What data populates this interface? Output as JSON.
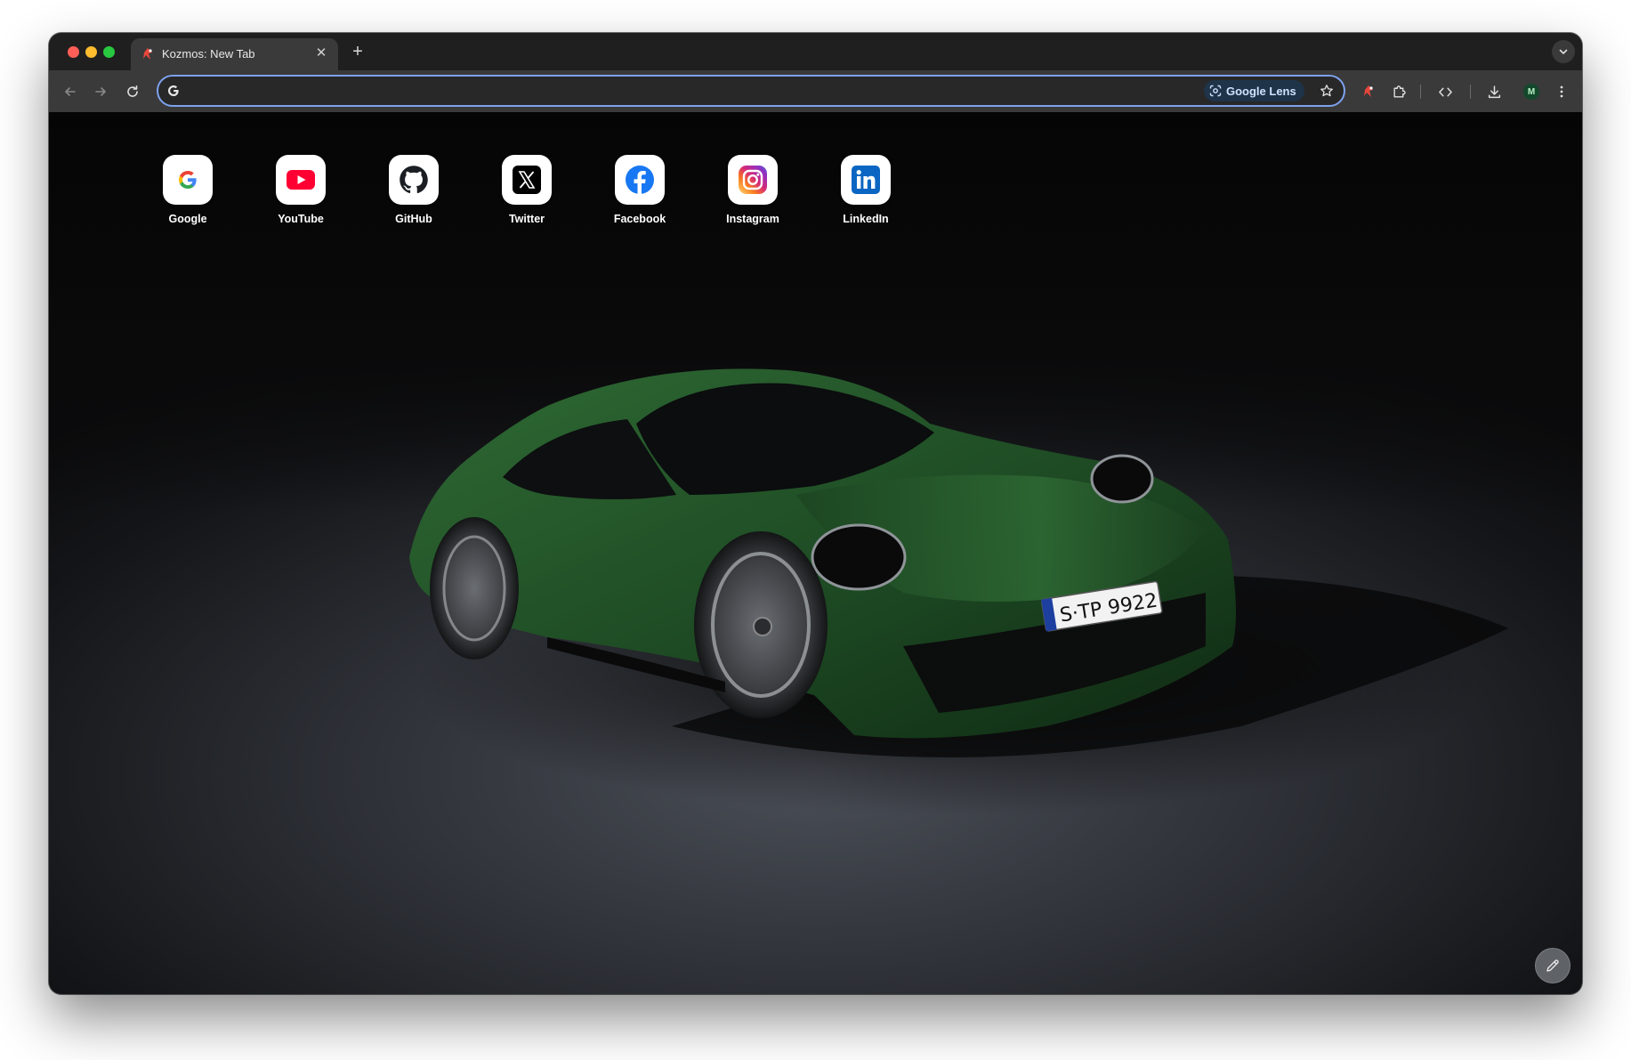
{
  "window": {
    "traffic_lights": [
      "close",
      "minimize",
      "zoom"
    ],
    "tab": {
      "title": "Kozmos: New Tab",
      "close_glyph": "✕",
      "favicon": "kozmos-icon"
    },
    "new_tab_glyph": "+"
  },
  "toolbar": {
    "omnibox": {
      "value": "",
      "engine_icon": "google-g-icon",
      "lens_label": "Google Lens"
    },
    "avatar_letter": "M"
  },
  "shortcuts": [
    {
      "label": "Google",
      "icon": "google-icon"
    },
    {
      "label": "YouTube",
      "icon": "youtube-icon"
    },
    {
      "label": "GitHub",
      "icon": "github-icon"
    },
    {
      "label": "Twitter",
      "icon": "x-twitter-icon"
    },
    {
      "label": "Facebook",
      "icon": "facebook-icon"
    },
    {
      "label": "Instagram",
      "icon": "instagram-icon"
    },
    {
      "label": "LinkedIn",
      "icon": "linkedin-icon"
    }
  ],
  "background": {
    "plate_text": "S·TP 9922"
  },
  "colors": {
    "accent": "#7da2ee",
    "tab_bg": "#3a3a3a",
    "car_green": "#1f4d25"
  }
}
